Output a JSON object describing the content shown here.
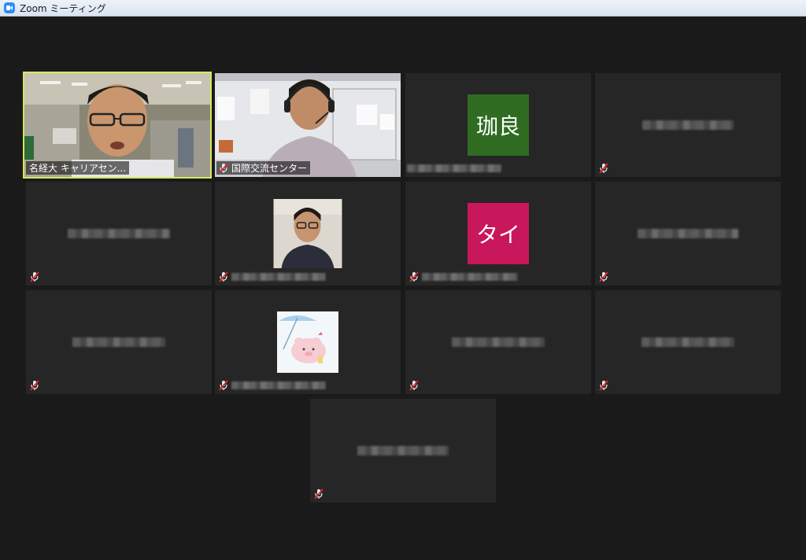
{
  "window": {
    "title": "Zoom ミーティング"
  },
  "participants": [
    {
      "id": "p1",
      "type": "video",
      "name": "名経大 キャリアセン...",
      "muted": false,
      "active": true
    },
    {
      "id": "p2",
      "type": "video",
      "name": "国際交流センター",
      "muted": true
    },
    {
      "id": "p3",
      "type": "initials",
      "initials": "珈良",
      "color": "#2f6c21",
      "muted": false
    },
    {
      "id": "p4",
      "type": "name-only",
      "muted": true
    },
    {
      "id": "p5",
      "type": "name-only",
      "muted": true
    },
    {
      "id": "p6",
      "type": "photo",
      "muted": true
    },
    {
      "id": "p7",
      "type": "initials",
      "initials": "タイ",
      "color": "#c8175a",
      "muted": true
    },
    {
      "id": "p8",
      "type": "name-only",
      "muted": true
    },
    {
      "id": "p9",
      "type": "name-only",
      "muted": true
    },
    {
      "id": "p10",
      "type": "photo",
      "muted": true
    },
    {
      "id": "p11",
      "type": "name-only",
      "muted": true
    },
    {
      "id": "p12",
      "type": "name-only",
      "muted": true
    },
    {
      "id": "p13",
      "type": "name-only",
      "muted": true
    }
  ]
}
